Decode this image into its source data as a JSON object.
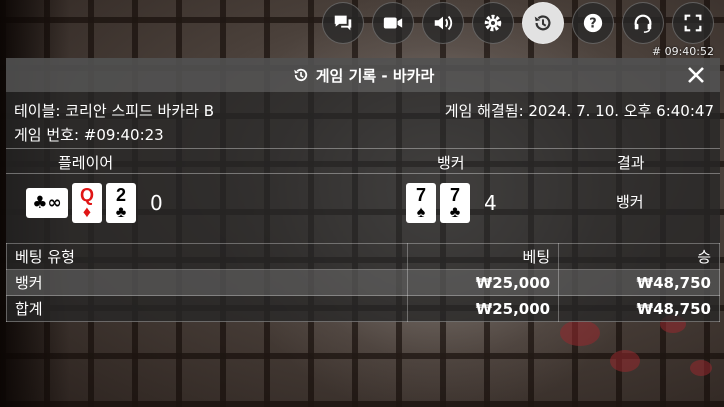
{
  "toolbar": {
    "buttons": [
      {
        "name": "chat",
        "icon": "chat-icon"
      },
      {
        "name": "video",
        "icon": "video-camera-icon"
      },
      {
        "name": "sound",
        "icon": "speaker-icon"
      },
      {
        "name": "settings",
        "icon": "gear-icon"
      },
      {
        "name": "history",
        "icon": "history-icon",
        "active": true
      },
      {
        "name": "help",
        "icon": "help-icon"
      },
      {
        "name": "support",
        "icon": "headset-icon"
      },
      {
        "name": "fullscreen",
        "icon": "fullscreen-icon"
      }
    ],
    "clock": "# 09:40:52"
  },
  "panel": {
    "title": "게임 기록 - 바카라",
    "table_label": "테이블: 코리안 스피드 바카라 B",
    "round_label": "게임 번호: #09:40:23",
    "resolved_label": "게임 해결됨: 2024. 7. 10. 오후 6:40:47"
  },
  "result": {
    "headers": {
      "player": "플레이어",
      "banker": "뱅커",
      "outcome": "결과"
    },
    "player": {
      "side_bet": "♣∞",
      "cards": [
        {
          "rank": "Q",
          "suit": "♦",
          "color": "red"
        },
        {
          "rank": "2",
          "suit": "♣",
          "color": "black"
        }
      ],
      "score": "0"
    },
    "banker": {
      "cards": [
        {
          "rank": "7",
          "suit": "♠",
          "color": "black"
        },
        {
          "rank": "7",
          "suit": "♣",
          "color": "black"
        }
      ],
      "score": "4"
    },
    "winner": "뱅커"
  },
  "bets": {
    "headers": {
      "type": "베팅 유형",
      "bet": "베팅",
      "win": "승"
    },
    "rows": [
      {
        "type": "뱅커",
        "bet": "₩25,000",
        "win": "₩48,750"
      }
    ],
    "total": {
      "type": "합계",
      "bet": "₩25,000",
      "win": "₩48,750"
    }
  },
  "colors": {
    "red_suit": "#e01515",
    "panel_bg": "#262626",
    "active_button": "#e2e2e2"
  }
}
